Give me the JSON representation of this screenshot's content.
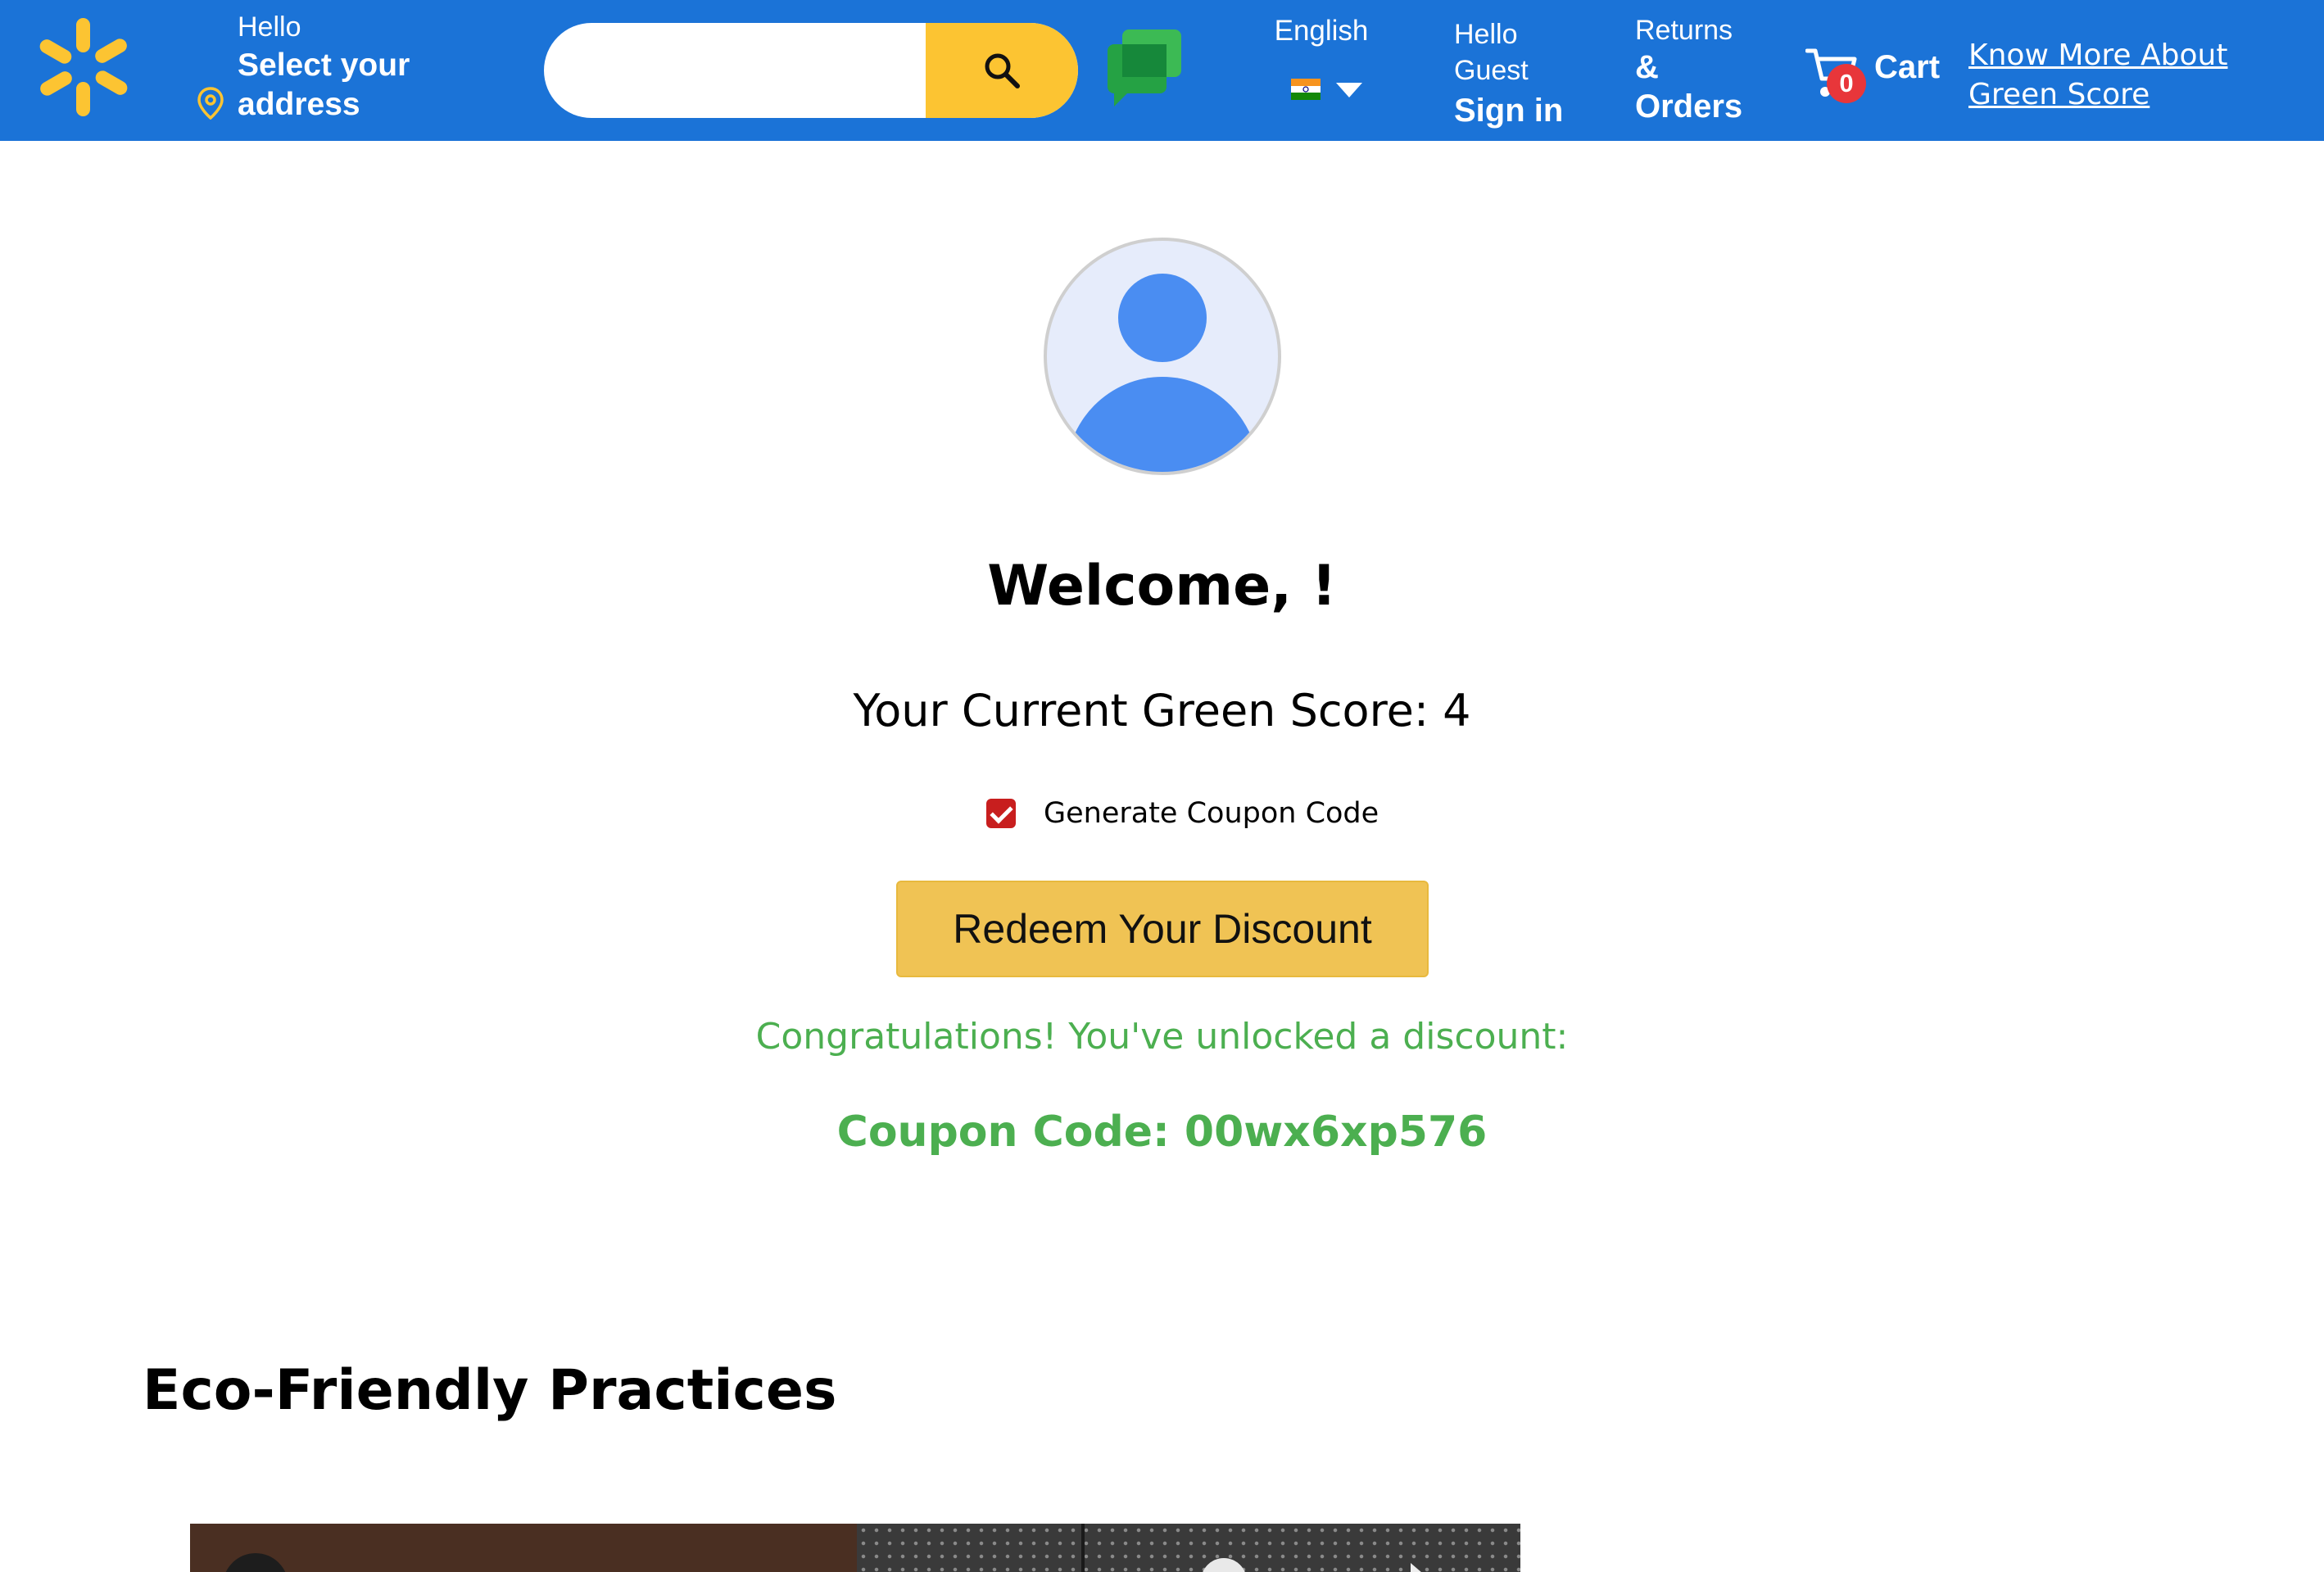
{
  "header": {
    "location": {
      "greeting": "Hello",
      "line1": "Select your",
      "line2": "address"
    },
    "search": {
      "value": "",
      "placeholder": ""
    },
    "language": {
      "label": "English",
      "flag": "india-flag-icon"
    },
    "account": {
      "line1": "Hello",
      "line2": "Guest",
      "action": "Sign in"
    },
    "returns": {
      "line1": "Returns",
      "line2": "&",
      "line3": "Orders"
    },
    "cart": {
      "count": "0",
      "label": "Cart"
    },
    "green_link": "Know More About Green Score"
  },
  "main": {
    "welcome": "Welcome, !",
    "score_text": "Your Current Green Score: 4",
    "generate_checkbox": {
      "label": "Generate Coupon Code",
      "checked": true
    },
    "redeem_button": "Redeem Your Discount",
    "congrats": "Congratulations! You've unlocked a discount:",
    "coupon": "Coupon Code: 00wx6xp576"
  },
  "section": {
    "title": "Eco-Friendly Practices"
  },
  "colors": {
    "header_bg": "#1b73d7",
    "spark": "#fcc432",
    "search_button": "#fcc432",
    "redeem_button": "#f0c354",
    "success_green": "#4caf50",
    "cart_badge": "#e8363a",
    "checkbox": "#c81e1e"
  }
}
